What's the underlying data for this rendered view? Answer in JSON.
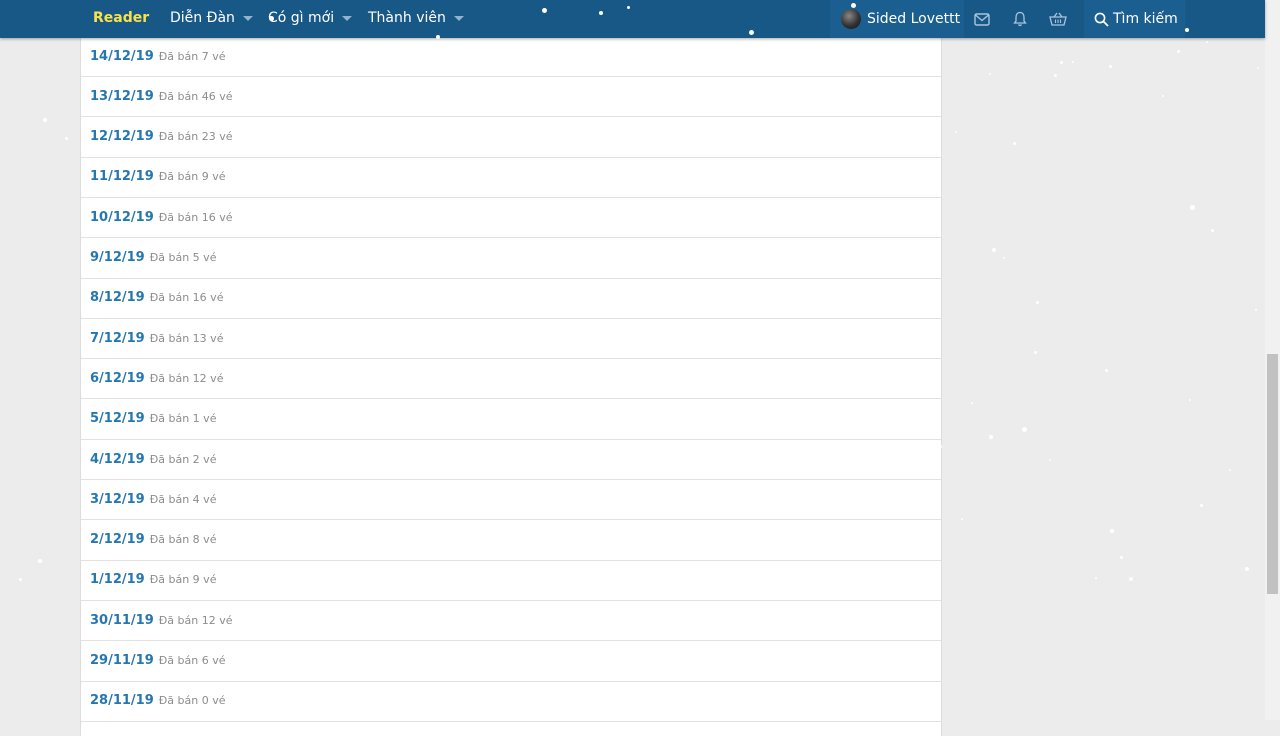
{
  "header": {
    "brand": "Reader",
    "nav": [
      {
        "label": "Diễn Đàn"
      },
      {
        "label": "Có gì mới"
      },
      {
        "label": "Thành viên"
      }
    ],
    "user_name": "Sided Lovettt",
    "search_label": "Tìm kiếm",
    "icons": [
      "envelope-icon",
      "bell-icon",
      "basket-icon",
      "search-icon"
    ]
  },
  "rows": [
    {
      "date": "14/12/19",
      "sold": "Đã bán 7 vé"
    },
    {
      "date": "13/12/19",
      "sold": "Đã bán 46 vé"
    },
    {
      "date": "12/12/19",
      "sold": "Đã bán 23 vé"
    },
    {
      "date": "11/12/19",
      "sold": "Đã bán 9 vé"
    },
    {
      "date": "10/12/19",
      "sold": "Đã bán 16 vé"
    },
    {
      "date": "9/12/19",
      "sold": "Đã bán 5 vé"
    },
    {
      "date": "8/12/19",
      "sold": "Đã bán 16 vé"
    },
    {
      "date": "7/12/19",
      "sold": "Đã bán 13 vé"
    },
    {
      "date": "6/12/19",
      "sold": "Đã bán 12 vé"
    },
    {
      "date": "5/12/19",
      "sold": "Đã bán 1 vé"
    },
    {
      "date": "4/12/19",
      "sold": "Đã bán 2 vé"
    },
    {
      "date": "3/12/19",
      "sold": "Đã bán 4 vé"
    },
    {
      "date": "2/12/19",
      "sold": "Đã bán 8 vé"
    },
    {
      "date": "1/12/19",
      "sold": "Đã bán 9 vé"
    },
    {
      "date": "30/11/19",
      "sold": "Đã bán 12 vé"
    },
    {
      "date": "29/11/19",
      "sold": "Đã bán 6 vé"
    },
    {
      "date": "28/11/19",
      "sold": "Đã bán 0 vé"
    }
  ],
  "colors": {
    "header_bg": "#185886",
    "brand": "#f9e24a",
    "link": "#2577b1",
    "muted": "#8c8c8c",
    "page_bg": "#ececec"
  }
}
